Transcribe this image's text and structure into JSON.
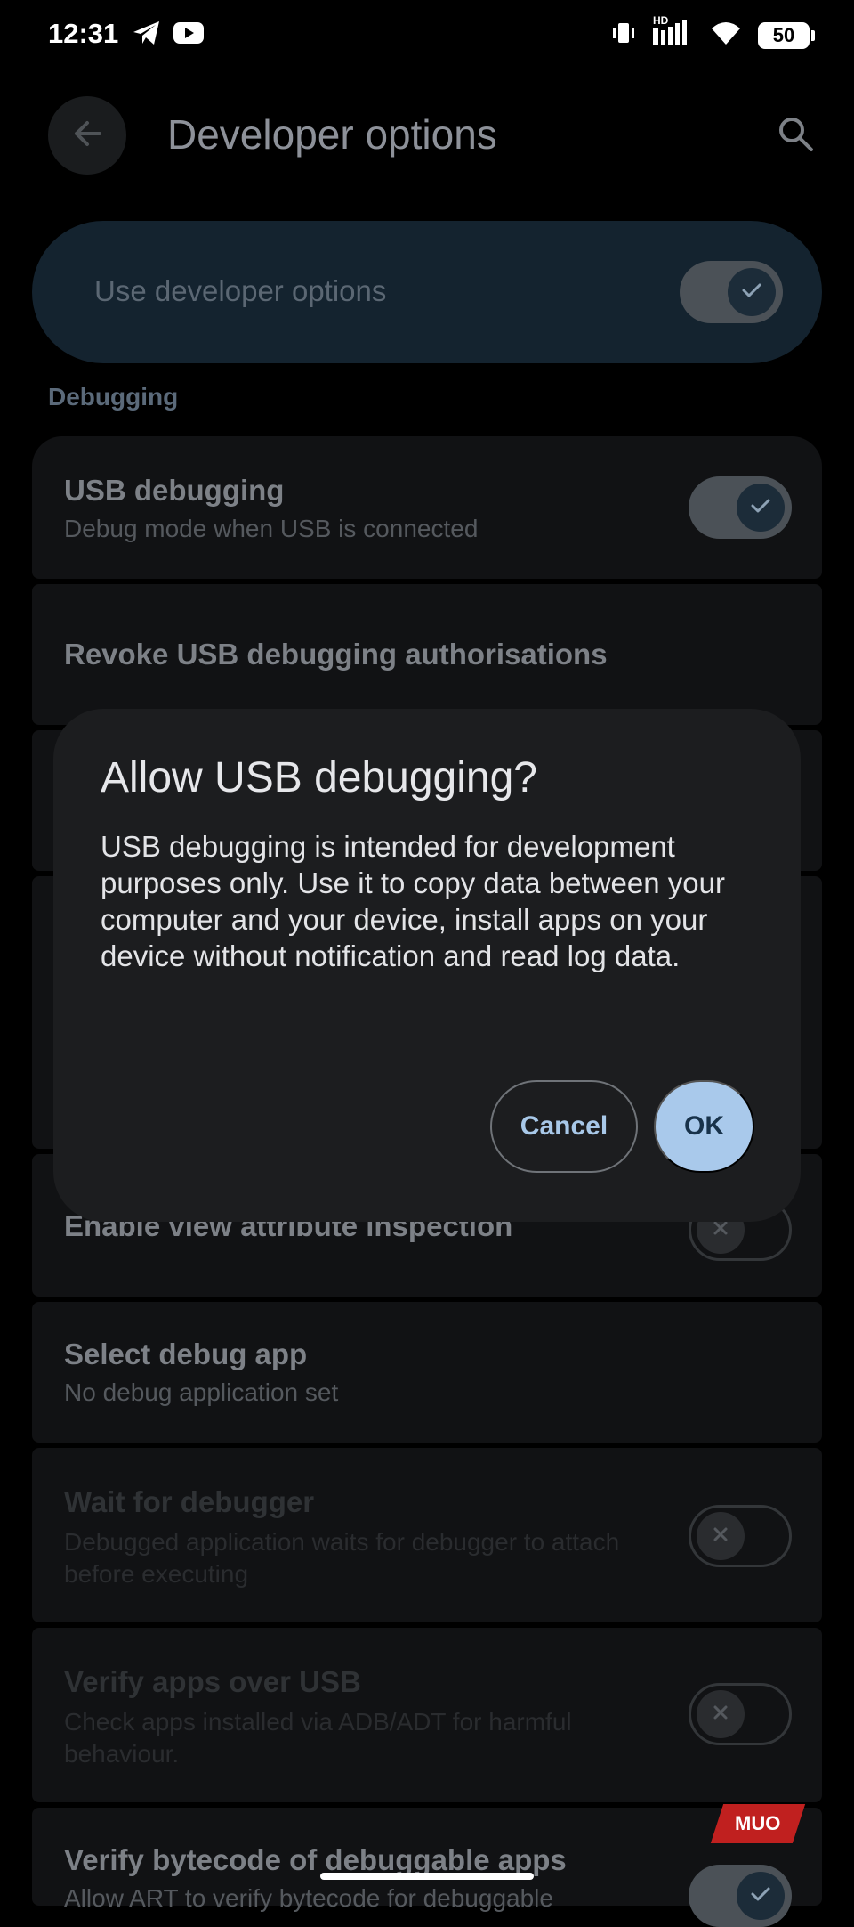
{
  "status_bar": {
    "time": "12:31",
    "network_label": "HD",
    "battery_level": "50",
    "icons": [
      "telegram-icon",
      "youtube-icon",
      "vibrate-icon",
      "signal-icon",
      "wifi-icon",
      "battery-icon"
    ]
  },
  "app_bar": {
    "title": "Developer options",
    "back_icon": "arrow-left-icon",
    "search_icon": "search-icon"
  },
  "master_toggle": {
    "label": "Use developer options",
    "state": "on"
  },
  "section": {
    "debugging": "Debugging"
  },
  "settings": {
    "usb_debugging": {
      "title": "USB debugging",
      "subtitle": "Debug mode when USB is connected",
      "state": "on"
    },
    "revoke": {
      "title": "Revoke USB debugging authorisations"
    },
    "view_attr": {
      "title": "Enable view attribute inspection",
      "state": "off"
    },
    "select_debug_app": {
      "title": "Select debug app",
      "subtitle": "No debug application set"
    },
    "wait_debugger": {
      "title": "Wait for debugger",
      "subtitle": "Debugged application waits for debugger to attach before executing",
      "state": "off"
    },
    "verify_usb": {
      "title": "Verify apps over USB",
      "subtitle": "Check apps installed via ADB/ADT for harmful behaviour.",
      "state": "off"
    },
    "verify_bytecode": {
      "title": "Verify bytecode of debuggable apps",
      "subtitle": "Allow ART to verify bytecode for debuggable",
      "state": "on"
    }
  },
  "dialog": {
    "title": "Allow USB debugging?",
    "body": "USB debugging is intended for development purposes only. Use it to copy data between your computer and your device, install apps on your device without notification and read log data.",
    "cancel_label": "Cancel",
    "ok_label": "OK"
  },
  "watermark": {
    "text": "MUO"
  },
  "colors": {
    "accent": "#a9c9eb",
    "background": "#000000",
    "dialog": "#1c1d1f",
    "card": "#111214"
  }
}
